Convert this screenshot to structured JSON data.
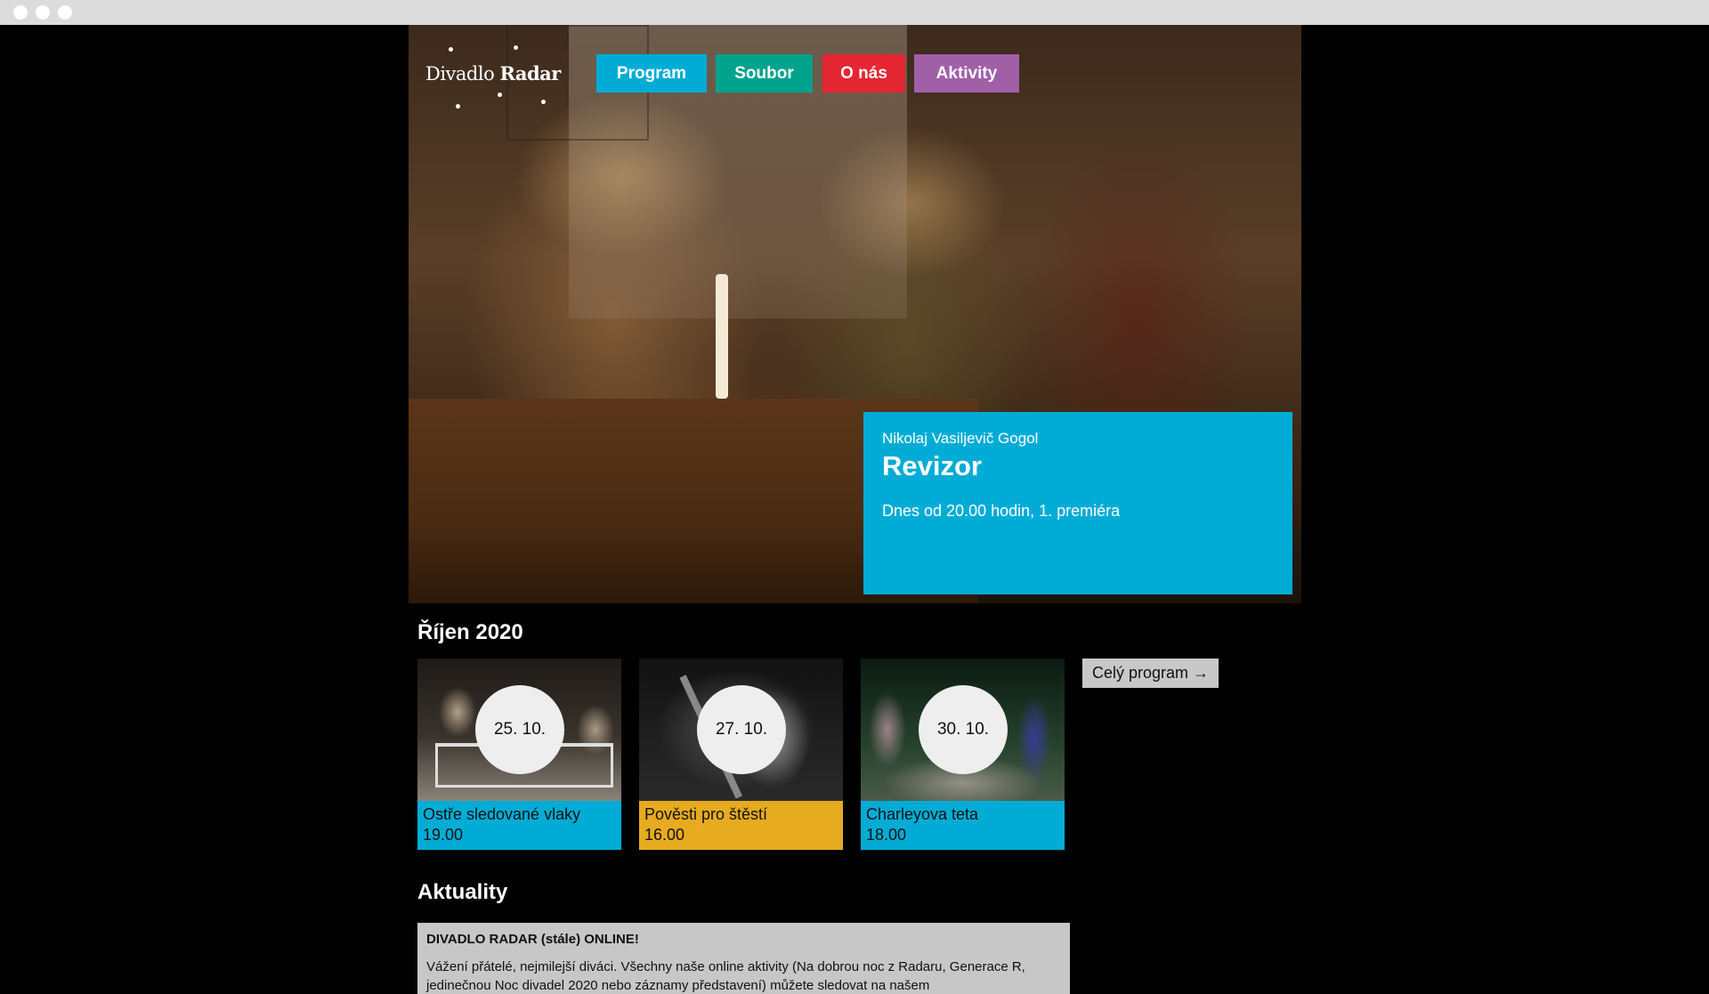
{
  "brand": {
    "prefix": "Divadlo",
    "name": "Radar"
  },
  "nav": [
    {
      "label": "Program",
      "color": "#00acd5"
    },
    {
      "label": "Soubor",
      "color": "#00a38c"
    },
    {
      "label": "O nás",
      "color": "#e52633"
    },
    {
      "label": "Aktivity",
      "color": "#a15fa8"
    }
  ],
  "feature": {
    "author": "Nikolaj Vasiljevič Gogol",
    "title": "Revizor",
    "when": "Dnes od 20.00 hodin, 1. premiéra",
    "color": "#00acd5"
  },
  "program": {
    "heading": "Říjen 2020",
    "items": [
      {
        "date": "25. 10.",
        "title": "Ostře sledované vlaky",
        "time": "19.00",
        "color": "#00acd5"
      },
      {
        "date": "27. 10.",
        "title": "Pověsti pro štěstí",
        "time": "16.00",
        "color": "#e6ab1f"
      },
      {
        "date": "30. 10.",
        "title": "Charleyova teta",
        "time": "18.00",
        "color": "#00acd5"
      }
    ],
    "all_label": "Celý program →"
  },
  "news": {
    "heading": "Aktuality",
    "headline": "DIVADLO RADAR (stále) ONLINE!",
    "body": "Vážení přátelé, nejmilejší diváci. Všechny naše online aktivity (Na dobrou noc z Radaru, Generace R, jedinečnou Noc divadel 2020 nebo záznamy představení) můžete sledovat na našem"
  }
}
